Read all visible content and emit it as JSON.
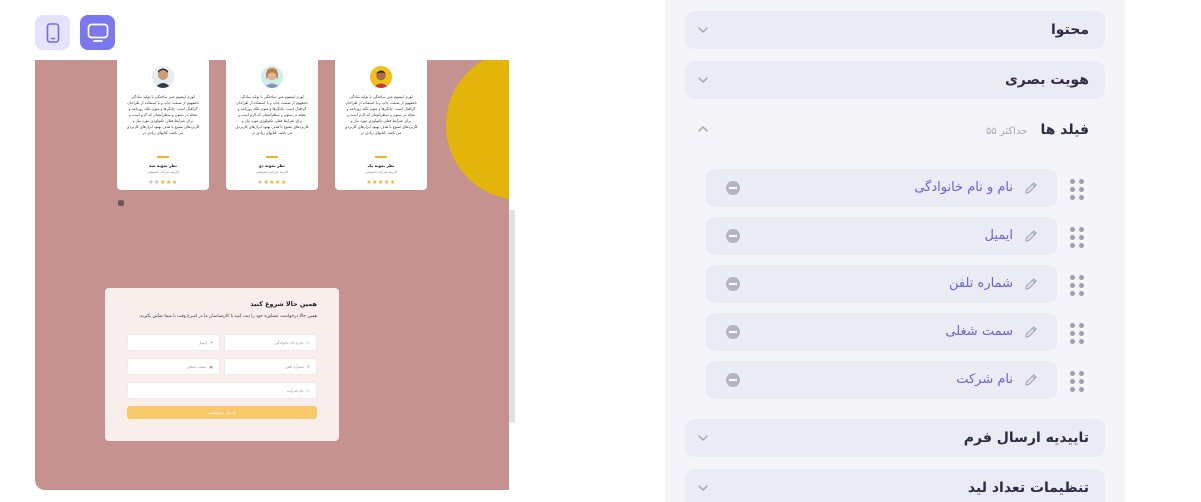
{
  "device_toggle": {
    "mobile_icon": "mobile-phone-icon",
    "desktop_icon": "desktop-monitor-icon",
    "active": "desktop"
  },
  "preview": {
    "testimonials": [
      {
        "text": "لورم ایپسوم متن ساختگی با تولید سادگی نامفهوم از صنعت چاپ و با استفاده از طراحان گرافیک است. چاپگرها و متون بلکه روزنامه و مجله در ستون و سطرآنچنان که لازم است و برای شرایط فعلی تکنولوژی مورد نیاز و کاربردهای متنوع با هدف بهبود ابزارهای کاربردی می باشد. کتابهای زیادی در",
        "name": "نظر نمونه سه",
        "role": "کارمند شرکت خصوصی",
        "rating": 3
      },
      {
        "text": "لورم ایپسوم متن ساختگی با تولید سادگی نامفهوم از صنعت چاپ و با استفاده از طراحان گرافیک است. چاپگرها و متون بلکه روزنامه و مجله در ستون و سطرآنچنان که لازم است و برای شرایط فعلی تکنولوژی مورد نیاز و کاربردهای متنوع با هدف بهبود ابزارهای کاربردی می باشد. کتابهای زیادی در",
        "name": "نظر نمونه دو",
        "role": "کارمند شرکت خصوصی",
        "rating": 4
      },
      {
        "text": "لورم ایپسوم متن ساختگی با تولید سادگی نامفهوم از صنعت چاپ و با استفاده از طراحان گرافیک است. چاپگرها و متون بلکه روزنامه و مجله در ستون و سطرآنچنان که لازم است و برای شرایط فعلی تکنولوژی مورد نیاز و کاربردهای متنوع با هدف بهبود ابزارهای کاربردی می باشد. کتابهای زیادی در",
        "name": "نظر نمونه یک",
        "role": "کارمند شرکت خصوصی",
        "rating": 5
      }
    ],
    "form": {
      "title": "همین حالا شروع کنید",
      "description": "همین حالا درخواست مشاوره خود را ثبت کنید تا کارشناسان ما در اسرع وقت با شما تماس بگیرند.",
      "fields": [
        "نام و نام خانوادگی",
        "ایمیل",
        "شماره تلفن",
        "سمت شغلی",
        "نام شرکت"
      ],
      "submit_label": "ارسال درخواست"
    },
    "colors": {
      "background": "#c69290",
      "accent_circle": "#e3b50a",
      "form_bg": "#faeeed",
      "button": "#f8c96a"
    }
  },
  "panel": {
    "sections": {
      "content": "محتوا",
      "visual_identity": "هویت بصری",
      "fields": "فیلد ها",
      "fields_limit": "حداکثر ۵۵",
      "submit_confirm": "تاییدیه ارسال فرم",
      "lead_count": "تنظیمات تعداد لید"
    },
    "fields": [
      {
        "label": "نام و نام خانوادگی"
      },
      {
        "label": "ایمیل"
      },
      {
        "label": "شماره تلفن"
      },
      {
        "label": "سمت شغلی"
      },
      {
        "label": "نام شرکت"
      }
    ],
    "colors": {
      "panel_bg": "#f4f4f9",
      "item_bg": "#ebebf6",
      "field_text": "#6764d8"
    }
  }
}
